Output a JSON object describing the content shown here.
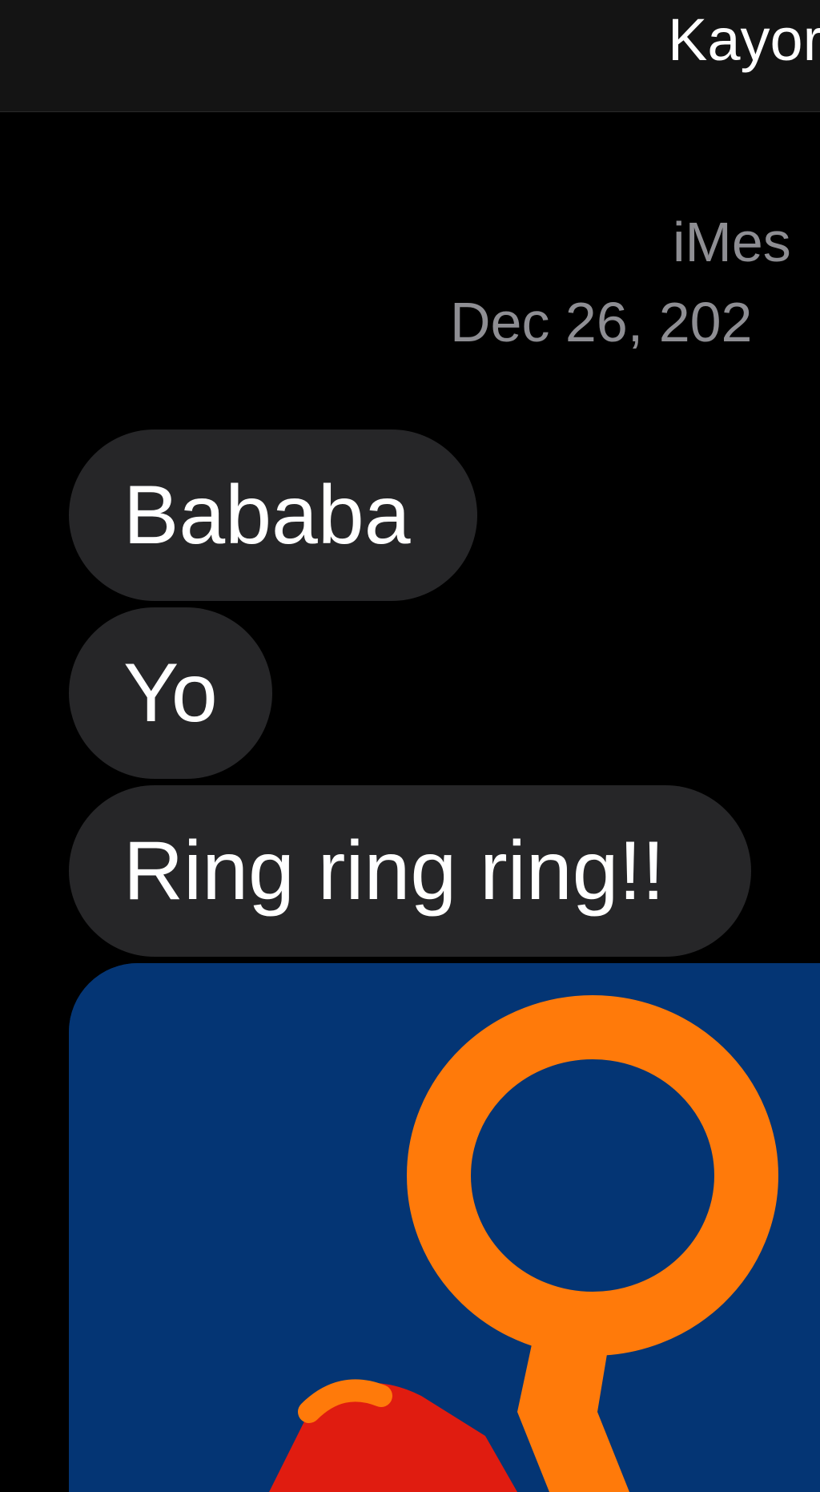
{
  "header": {
    "contact_name": "Kayor"
  },
  "conversation": {
    "service_label": "iMes",
    "timestamp": "Dec 26, 202"
  },
  "messages": [
    {
      "text": "Bababa"
    },
    {
      "text": "Yo"
    },
    {
      "text": "Ring ring ring!!"
    }
  ],
  "attachment": {
    "background_color": "#043574",
    "figure_color": "#ff7a0a",
    "accent_color": "#e01c10"
  }
}
